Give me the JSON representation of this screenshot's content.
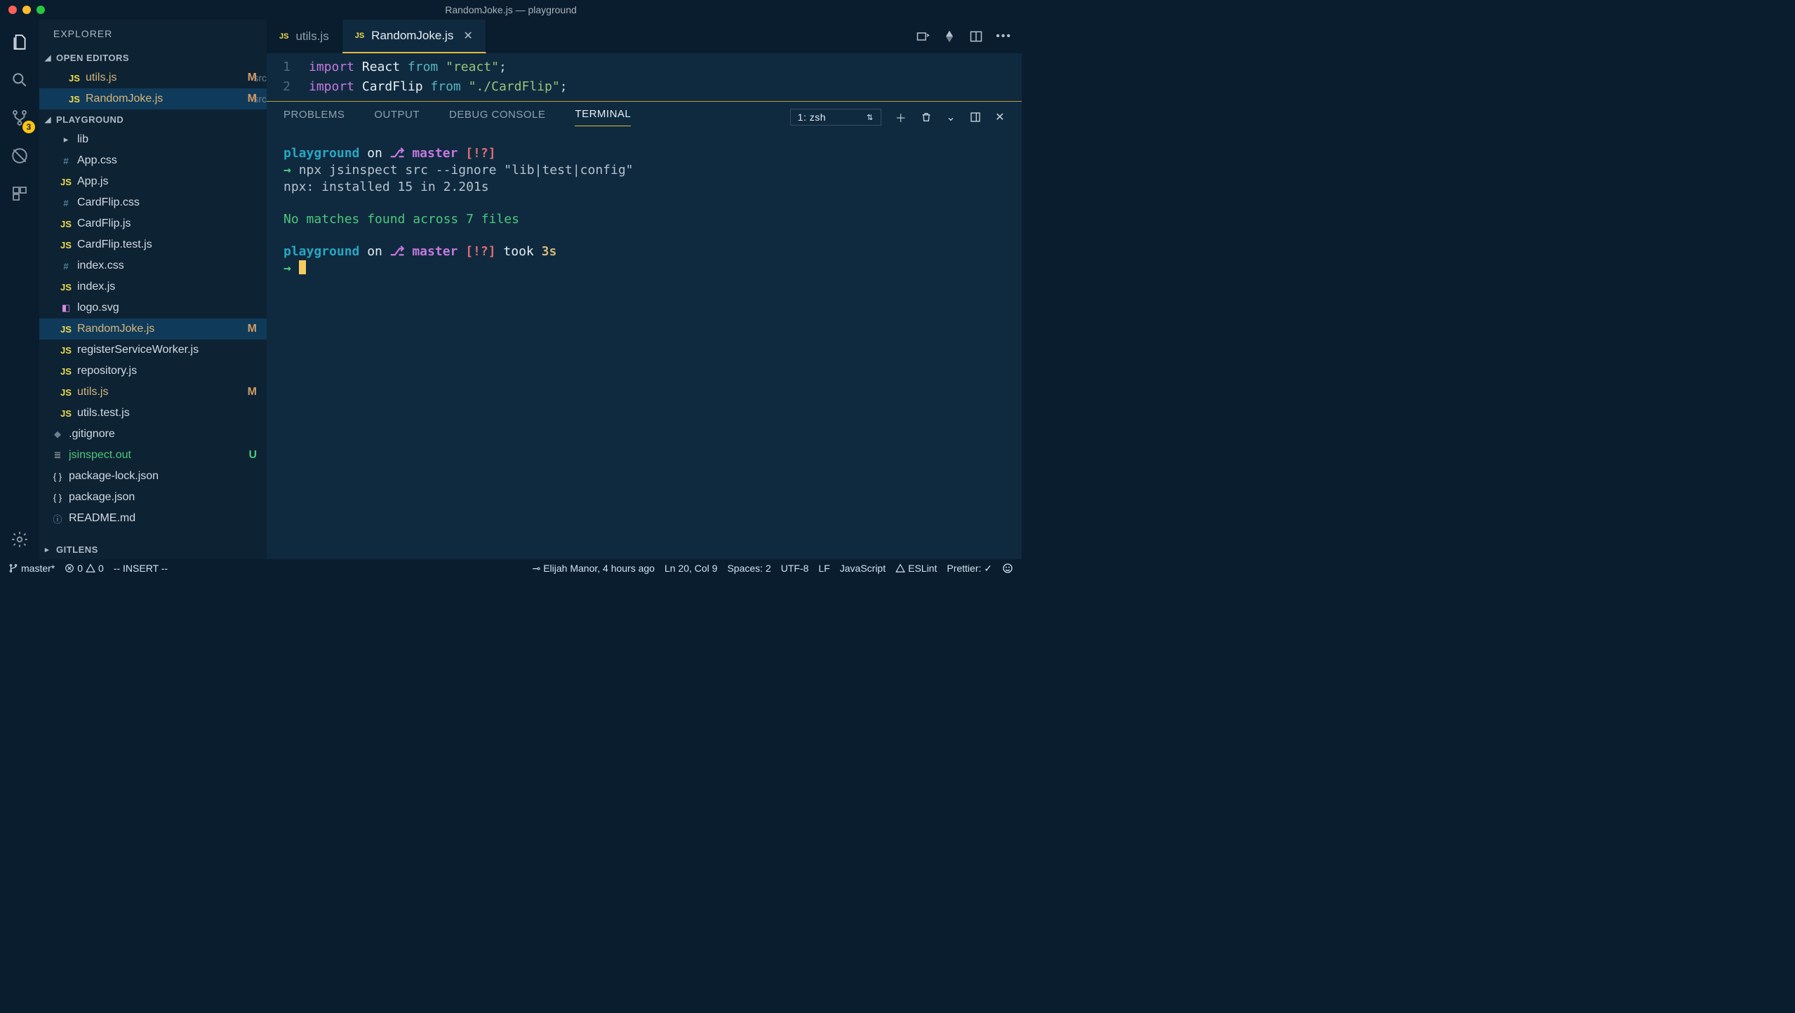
{
  "titlebar": {
    "title": "RandomJoke.js — playground"
  },
  "activity_bar": {
    "scm_badge": "3"
  },
  "sidebar": {
    "title": "EXPLORER",
    "sections": {
      "open_editors": "OPEN EDITORS",
      "workspace": "PLAYGROUND",
      "gitlens": "GITLENS"
    },
    "open_editors": [
      {
        "icon": "JS",
        "name": "utils.js",
        "src": "src",
        "status": "M"
      },
      {
        "icon": "JS",
        "name": "RandomJoke.js",
        "src": "src",
        "status": "M"
      }
    ],
    "files": [
      {
        "icon": "chev",
        "name": "lib",
        "dir": true
      },
      {
        "icon": "#",
        "name": "App.css"
      },
      {
        "icon": "JS",
        "name": "App.js"
      },
      {
        "icon": "#",
        "name": "CardFlip.css"
      },
      {
        "icon": "JS",
        "name": "CardFlip.js"
      },
      {
        "icon": "JS",
        "name": "CardFlip.test.js"
      },
      {
        "icon": "#",
        "name": "index.css"
      },
      {
        "icon": "JS",
        "name": "index.js"
      },
      {
        "icon": "svg",
        "name": "logo.svg"
      },
      {
        "icon": "JS",
        "name": "RandomJoke.js",
        "status": "M",
        "selected": true
      },
      {
        "icon": "JS",
        "name": "registerServiceWorker.js"
      },
      {
        "icon": "JS",
        "name": "repository.js"
      },
      {
        "icon": "JS",
        "name": "utils.js",
        "status": "M"
      },
      {
        "icon": "JS",
        "name": "utils.test.js"
      },
      {
        "icon": "diamond",
        "name": ".gitignore",
        "indent2": true
      },
      {
        "icon": "lines",
        "name": "jsinspect.out",
        "status": "U",
        "indent2": true
      },
      {
        "icon": "{}",
        "name": "package-lock.json",
        "indent2": true
      },
      {
        "icon": "{}",
        "name": "package.json",
        "indent2": true
      },
      {
        "icon": "info",
        "name": "README.md",
        "indent2": true
      }
    ]
  },
  "tabs": [
    {
      "icon": "JS",
      "label": "utils.js",
      "active": false
    },
    {
      "icon": "JS",
      "label": "RandomJoke.js",
      "active": true,
      "closeable": true
    }
  ],
  "code": {
    "lines": [
      {
        "n": "1",
        "tokens": [
          "import",
          " ",
          "React",
          " ",
          "from",
          " ",
          "\"react\"",
          ";"
        ]
      },
      {
        "n": "2",
        "tokens": [
          "import",
          " ",
          "CardFlip",
          " ",
          "from",
          " ",
          "\"./CardFlip\"",
          ";"
        ]
      }
    ]
  },
  "panel": {
    "tabs": {
      "problems": "PROBLEMS",
      "output": "OUTPUT",
      "debug": "DEBUG CONSOLE",
      "terminal": "TERMINAL"
    },
    "terminal_select": "1: zsh"
  },
  "terminal": {
    "prompt1": {
      "cwd": "playground",
      "on": "on",
      "branch_glyph": "⎇",
      "branch": "master",
      "flags": "[!?]"
    },
    "cmd1_arrow": "→",
    "cmd1": "npx jsinspect src --ignore \"lib|test|config\"",
    "out1": "npx: installed 15 in 2.201s",
    "out2": "No matches found across 7 files",
    "prompt2": {
      "cwd": "playground",
      "on": "on",
      "branch_glyph": "⎇",
      "branch": "master",
      "flags": "[!?]",
      "took": "took",
      "dur": "3s"
    },
    "cmd2_arrow": "→"
  },
  "statusbar": {
    "branch": "master*",
    "errors": "0",
    "warnings": "0",
    "mode": "-- INSERT --",
    "blame": "Elijah Manor, 4 hours ago",
    "pos": "Ln 20, Col 9",
    "spaces": "Spaces: 2",
    "encoding": "UTF-8",
    "eol": "LF",
    "lang": "JavaScript",
    "eslint": "ESLint",
    "prettier": "Prettier: ✓"
  }
}
